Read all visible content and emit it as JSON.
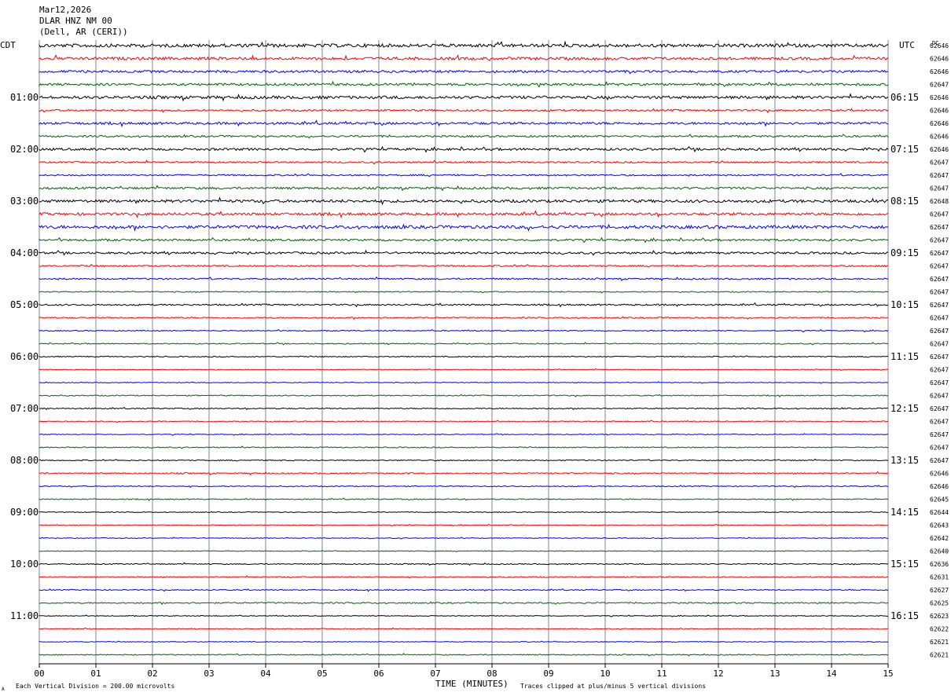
{
  "header": {
    "date": "Mar12,2026",
    "station": "DLAR HNZ NM 00",
    "location": "(Dell, AR (CERI))"
  },
  "labels": {
    "left_zone": "CDT",
    "right_zone": "UTC",
    "dc_header": "DC",
    "x_title": "TIME (MINUTES)",
    "scale_note": "Each Vertical Division =  200.00 microvolts",
    "clip_note": "Traces clipped at plus/minus 5 vertical divisions",
    "corner_mark": "A"
  },
  "colors": {
    "trace_cycle": [
      "#000000",
      "#ff0000",
      "#0000ff",
      "#006400"
    ],
    "grid": "#8080a0",
    "text": "#000000"
  },
  "chart_data": {
    "type": "line",
    "subtype": "helicorder",
    "x_ticks": [
      "00",
      "01",
      "02",
      "03",
      "04",
      "05",
      "06",
      "07",
      "08",
      "09",
      "10",
      "11",
      "12",
      "13",
      "14",
      "15"
    ],
    "xlim": [
      0,
      15
    ],
    "rows_per_hour": 4,
    "row_count": 48,
    "left_hour_labels": [
      "01:00",
      "02:00",
      "03:00",
      "04:00",
      "05:00",
      "06:00",
      "07:00",
      "08:00",
      "09:00",
      "10:00",
      "11:00"
    ],
    "right_hour_labels": [
      "06:15",
      "07:15",
      "08:15",
      "09:15",
      "10:15",
      "11:15",
      "12:15",
      "13:15",
      "14:15",
      "15:15",
      "16:15"
    ],
    "dc_values": [
      62646,
      62646,
      62646,
      62647,
      62646,
      62646,
      62646,
      62646,
      62646,
      62647,
      62647,
      62647,
      62648,
      62647,
      62647,
      62647,
      62647,
      62647,
      62647,
      62647,
      62647,
      62647,
      62647,
      62647,
      62647,
      62647,
      62647,
      62647,
      62647,
      62647,
      62647,
      62647,
      62647,
      62646,
      62646,
      62645,
      62644,
      62643,
      62642,
      62640,
      62636,
      62631,
      62627,
      62625,
      62623,
      62622,
      62621,
      62621
    ],
    "trace_noise": [
      1.3,
      1.1,
      0.9,
      0.9,
      1.1,
      0.7,
      0.9,
      0.7,
      0.9,
      0.6,
      0.6,
      0.8,
      1.1,
      1.0,
      1.2,
      0.8,
      0.8,
      0.6,
      0.6,
      0.4,
      0.6,
      0.5,
      0.4,
      0.4,
      0.4,
      0.3,
      0.3,
      0.4,
      0.4,
      0.4,
      0.3,
      0.4,
      0.4,
      0.5,
      0.4,
      0.4,
      0.3,
      0.3,
      0.3,
      0.3,
      0.4,
      0.4,
      0.4,
      0.5,
      0.3,
      0.3,
      0.3,
      0.4
    ]
  }
}
